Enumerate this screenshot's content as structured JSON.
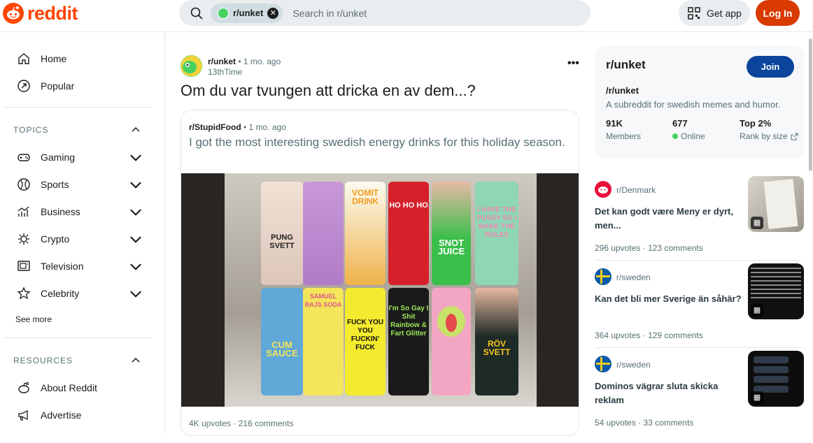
{
  "header": {
    "brand": "reddit",
    "search_chip": "r/unket",
    "search_placeholder": "Search in r/unket",
    "get_app": "Get app",
    "login": "Log In"
  },
  "nav": {
    "home": "Home",
    "popular": "Popular",
    "topics_heading": "TOPICS",
    "topics": [
      "Gaming",
      "Sports",
      "Business",
      "Crypto",
      "Television",
      "Celebrity"
    ],
    "see_more": "See more",
    "resources_heading": "RESOURCES",
    "resources": [
      "About Reddit",
      "Advertise"
    ]
  },
  "post": {
    "subreddit": "r/unket",
    "time": "1 mo. ago",
    "author": "13thTime",
    "title": "Om du var tvungen att dricka en av dem...?",
    "crosspost": {
      "subreddit": "r/StupidFood",
      "time": "1 mo. ago",
      "title": "I got the most interesting swedish energy drinks for this holiday season.",
      "upvotes": "4K upvotes",
      "comments": "216 comments"
    },
    "can_labels": [
      "PUNG SVETT",
      "VOMIT DRINK",
      "HO HO HO",
      "SNOT JUICE",
      "I HAVE THE PUSSY SO I MAKE THE RULES",
      "CUM SAUCE",
      "SAMUEL BAJS SODA",
      "FUCK YOU YOU FUCKIN' FUCK",
      "I'm So Gay I Shit Rainbow & Fart Glitter",
      "RÖV SVETT"
    ]
  },
  "sidebar": {
    "name": "r/unket",
    "join": "Join",
    "path": "/r/unket",
    "description": "A subreddit for swedish memes and humor.",
    "members_value": "91K",
    "members_label": "Members",
    "online_value": "677",
    "online_label": "Online",
    "rank_value": "Top 2%",
    "rank_label": "Rank by size"
  },
  "related": [
    {
      "subreddit": "r/Denmark",
      "title": "Det kan godt være Meny er dyrt, men...",
      "upvotes": "296 upvotes",
      "comments": "123 comments"
    },
    {
      "subreddit": "r/sweden",
      "title": "Kan det bli mer Sverige än såhär?",
      "upvotes": "364 upvotes",
      "comments": "129 comments"
    },
    {
      "subreddit": "r/sweden",
      "title": "Dominos vägrar sluta skicka reklam",
      "upvotes": "54 upvotes",
      "comments": "33 comments"
    }
  ],
  "colors": {
    "brand": "#ff4500",
    "login": "#d93a00",
    "join": "#0a449b",
    "online": "#46d160"
  }
}
